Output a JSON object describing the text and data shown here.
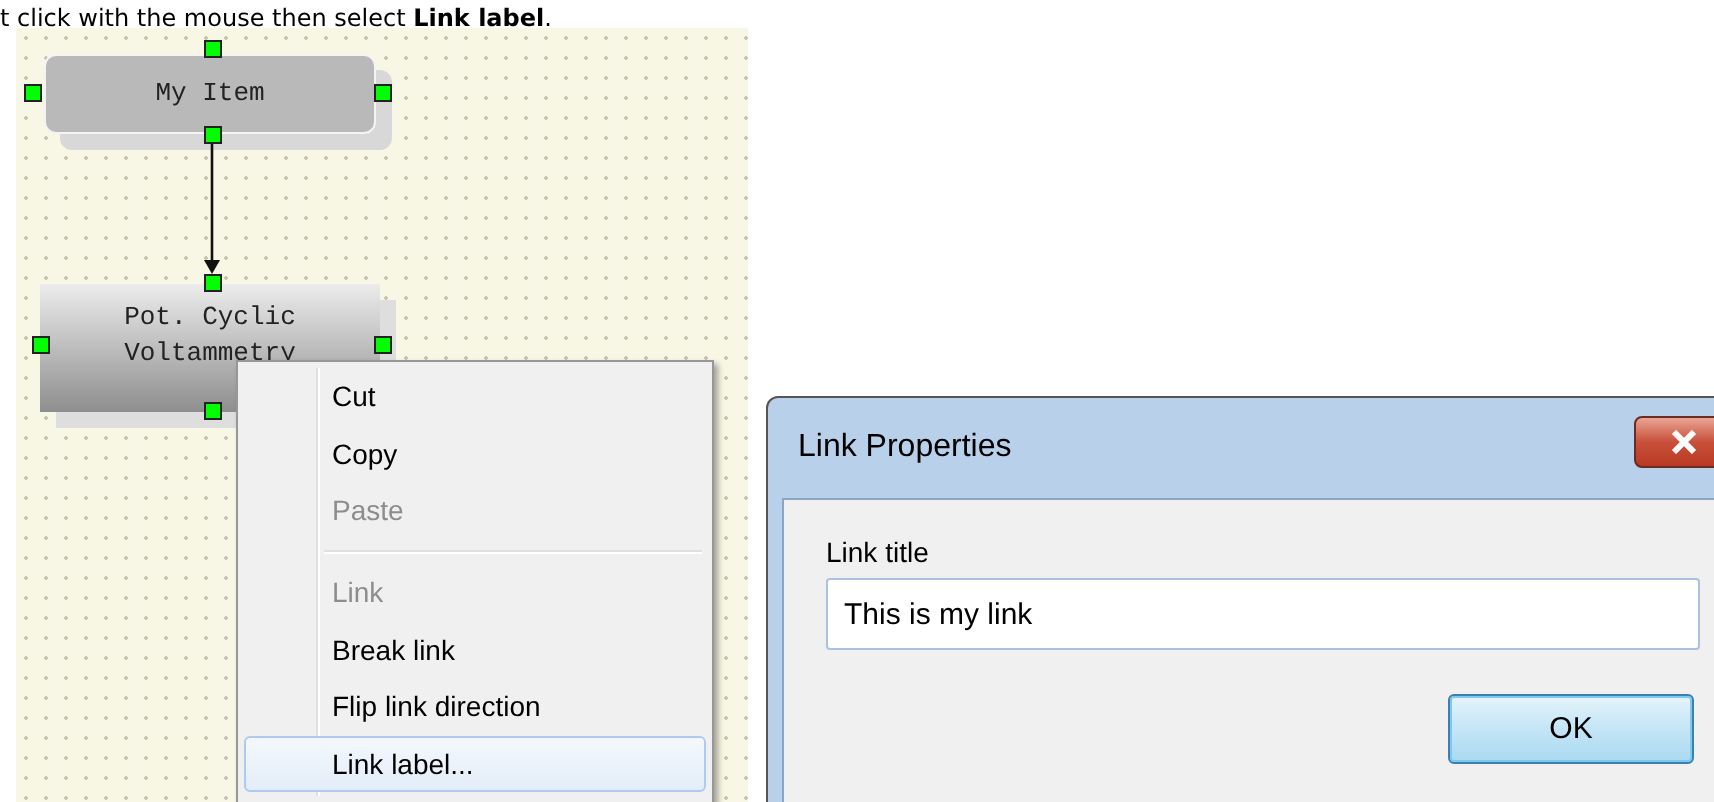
{
  "caption": "t click with the mouse then select **Link label**.",
  "diagram": {
    "nodes": [
      {
        "label": "My Item",
        "kind": "plain",
        "selected": true
      },
      {
        "label": "Pot. Cyclic Voltammetry",
        "kind": "gradient",
        "selected": true
      }
    ]
  },
  "context_menu": {
    "groups": [
      [
        {
          "label": "Cut",
          "disabled": false,
          "selected": false
        },
        {
          "label": "Copy",
          "disabled": false,
          "selected": false
        },
        {
          "label": "Paste",
          "disabled": true,
          "selected": false
        }
      ],
      [
        {
          "label": "Link",
          "disabled": true,
          "selected": false
        },
        {
          "label": "Break link",
          "disabled": false,
          "selected": false
        },
        {
          "label": "Flip link direction",
          "disabled": false,
          "selected": false
        },
        {
          "label": "Link label...",
          "disabled": false,
          "selected": true
        }
      ]
    ]
  },
  "dialog": {
    "title": "Link Properties",
    "field": {
      "label": "Link title",
      "value": "This is my link"
    },
    "buttons": [
      "OK"
    ]
  }
}
